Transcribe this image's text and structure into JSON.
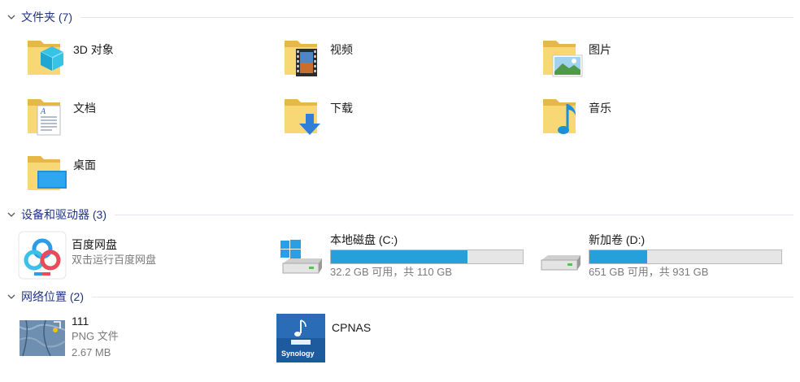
{
  "groups": {
    "folders": {
      "title": "文件夹 (7)"
    },
    "drives": {
      "title": "设备和驱动器 (3)"
    },
    "network": {
      "title": "网络位置 (2)"
    }
  },
  "folders": [
    {
      "label": "3D 对象",
      "icon": "3d-objects-folder-icon"
    },
    {
      "label": "视频",
      "icon": "videos-folder-icon"
    },
    {
      "label": "图片",
      "icon": "pictures-folder-icon"
    },
    {
      "label": "文档",
      "icon": "documents-folder-icon"
    },
    {
      "label": "下载",
      "icon": "downloads-folder-icon"
    },
    {
      "label": "音乐",
      "icon": "music-folder-icon"
    },
    {
      "label": "桌面",
      "icon": "desktop-folder-icon"
    }
  ],
  "drives": {
    "baidu": {
      "label": "百度网盘",
      "sub": "双击运行百度网盘"
    },
    "c": {
      "label": "本地磁盘 (C:)",
      "info": "32.2 GB 可用，共 110 GB",
      "used_fraction": 0.71
    },
    "d": {
      "label": "新加卷 (D:)",
      "info": "651 GB 可用，共 931 GB",
      "used_fraction": 0.3
    }
  },
  "network": {
    "item1": {
      "label": "111",
      "type": "PNG 文件",
      "size": "2.67 MB"
    },
    "item2": {
      "label": "CPNAS",
      "logo_text": "Synology"
    }
  },
  "colors": {
    "header": "#1e3287",
    "bar_fill": "#26a0da",
    "folder": "#f8d775"
  }
}
